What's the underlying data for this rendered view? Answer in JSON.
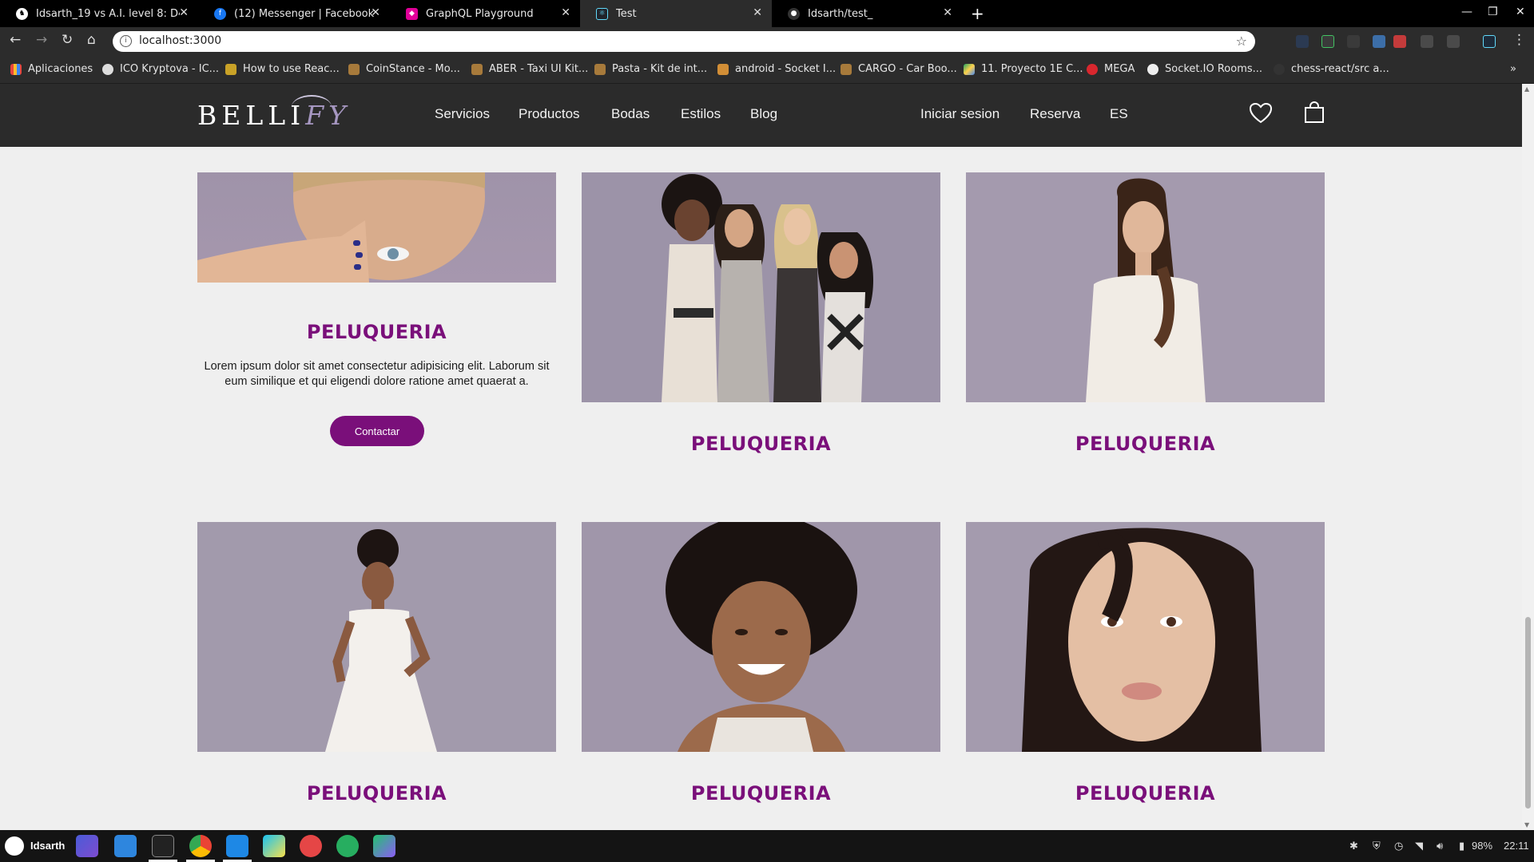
{
  "browser": {
    "tabs": [
      {
        "title": "Idsarth_19 vs A.I. level 8: D40",
        "active": false
      },
      {
        "title": "(12) Messenger | Facebook",
        "active": false
      },
      {
        "title": "GraphQL Playground",
        "active": false
      },
      {
        "title": "Test",
        "active": true
      },
      {
        "title": "Idsarth/test_",
        "active": false
      }
    ],
    "new_tab": "+",
    "url": "localhost:3000",
    "bookmarks": [
      "Aplicaciones",
      "ICO Kryptova - IC...",
      "How to use Reac...",
      "CoinStance - Mo...",
      "ABER - Taxi UI Kit...",
      "Pasta - Kit de int...",
      "android - Socket I...",
      "CARGO - Car Boo...",
      "11. Proyecto 1E C...",
      "MEGA",
      "Socket.IO Rooms...",
      "chess-react/src a..."
    ],
    "bookmarks_more": "»"
  },
  "site": {
    "logo": {
      "text_main": "BELLI",
      "text_accent": "FY"
    },
    "nav": [
      "Servicios",
      "Productos",
      "Bodas",
      "Estilos",
      "Blog"
    ],
    "right_nav": [
      "Iniciar sesion",
      "Reserva",
      "ES"
    ],
    "cards": [
      {
        "title": "PELUQUERIA",
        "text": "Lorem ipsum dolor sit amet consectetur adipisicing elit. Laborum sit eum similique et qui eligendi dolore ratione amet quaerat a.",
        "button": "Contactar"
      },
      {
        "title": "PELUQUERIA"
      },
      {
        "title": "PELUQUERIA"
      },
      {
        "title": "PELUQUERIA"
      },
      {
        "title": "PELUQUERIA"
      },
      {
        "title": "PELUQUERIA"
      }
    ],
    "accent_color": "#7a0f7a"
  },
  "taskbar": {
    "user": "Idsarth",
    "battery": "98%",
    "clock": "22:11"
  }
}
